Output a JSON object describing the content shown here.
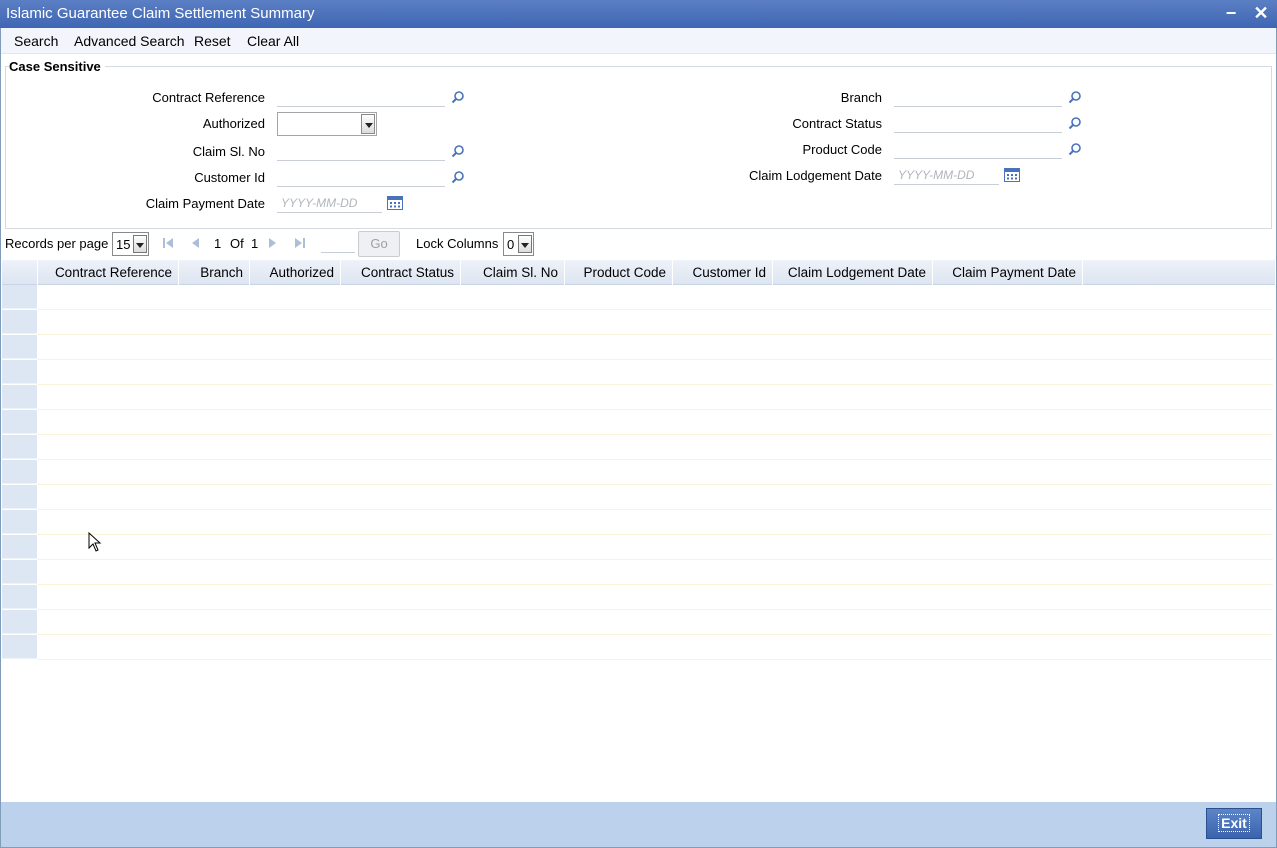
{
  "window": {
    "title": "Islamic Guarantee Claim Settlement Summary",
    "minimize": "−",
    "close": "✕"
  },
  "menu": {
    "search": "Search",
    "advanced_search": "Advanced Search",
    "reset": "Reset",
    "clear_all": "Clear All"
  },
  "criteria": {
    "legend": "Case Sensitive",
    "contract_reference": {
      "label": "Contract Reference",
      "value": ""
    },
    "authorized": {
      "label": "Authorized",
      "value": ""
    },
    "claim_sl_no": {
      "label": "Claim Sl. No",
      "value": ""
    },
    "customer_id": {
      "label": "Customer Id",
      "value": ""
    },
    "claim_payment_date": {
      "label": "Claim Payment Date",
      "placeholder": "YYYY-MM-DD"
    },
    "branch": {
      "label": "Branch",
      "value": ""
    },
    "contract_status": {
      "label": "Contract Status",
      "value": ""
    },
    "product_code": {
      "label": "Product Code",
      "value": ""
    },
    "claim_lodgement_date": {
      "label": "Claim Lodgement Date",
      "placeholder": "YYYY-MM-DD"
    }
  },
  "pager": {
    "records_per_page_label": "Records per page",
    "records_per_page": "15",
    "current_page": "1",
    "of_label": "Of",
    "total_pages": "1",
    "go_label": "Go",
    "lock_columns_label": "Lock Columns",
    "lock_columns": "0"
  },
  "grid": {
    "columns": [
      "Contract Reference",
      "Branch",
      "Authorized",
      "Contract Status",
      "Claim Sl. No",
      "Product Code",
      "Customer Id",
      "Claim Lodgement Date",
      "Claim Payment Date"
    ],
    "row_count": 15
  },
  "footer": {
    "exit_label": "Exit"
  },
  "colors": {
    "titlebar": "#3f66b3",
    "footer": "#bcd2ec",
    "accent": "#4a73bb"
  },
  "icons": {
    "lookup": "magnifier-icon",
    "calendar": "calendar-icon"
  }
}
